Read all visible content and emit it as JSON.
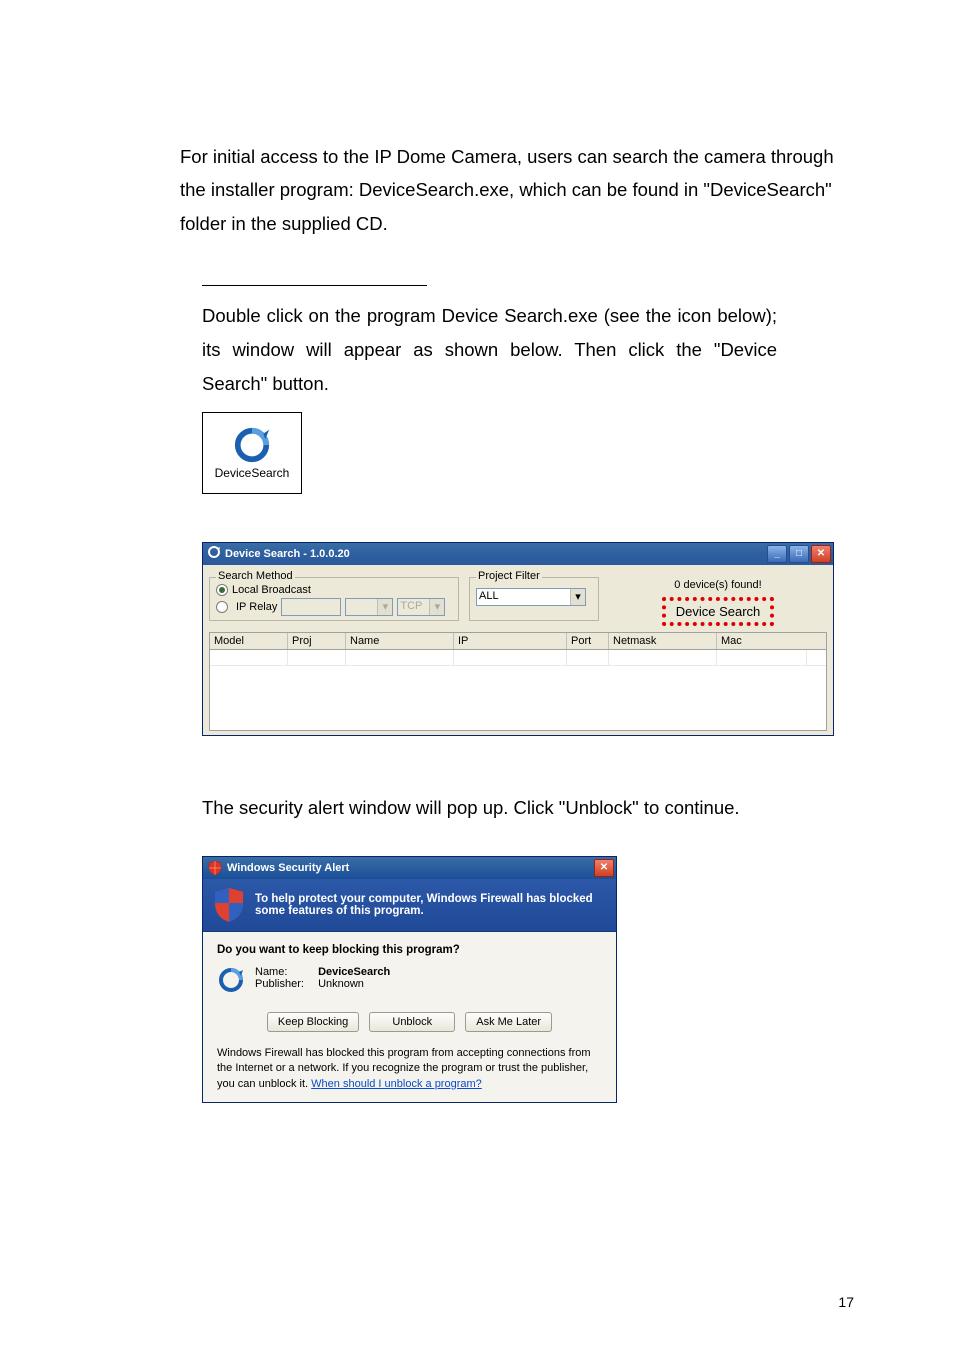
{
  "intro": "For initial access to the IP Dome Camera, users can search the camera through the installer program: DeviceSearch.exe, which can be found in \"DeviceSearch\" folder in the supplied CD.",
  "step": {
    "text": "Double click on the program Device Search.exe (see the icon below); its window will appear as shown below. Then click the \"Device Search\" button.",
    "icon_label": "DeviceSearch",
    "icon_name": "device-search-icon"
  },
  "ds_window": {
    "title": "Device Search - 1.0.0.20",
    "search_method": {
      "legend": "Search Method",
      "opt1": "Local Broadcast",
      "opt2": "IP Relay",
      "proto": "TCP"
    },
    "filter": {
      "legend": "Project Filter",
      "value": "ALL"
    },
    "found": "0 device(s) found!",
    "search_btn": "Device Search",
    "headers": [
      "Model",
      "Proj",
      "Name",
      "IP",
      "Port",
      "Netmask",
      "Mac"
    ]
  },
  "after_ds": "The security alert window will pop up. Click \"Unblock\" to continue.",
  "sa_window": {
    "title": "Windows Security Alert",
    "banner": "To help protect your computer,  Windows Firewall has blocked some features of this program.",
    "question": "Do you want to keep blocking this program?",
    "name_label": "Name:",
    "name_value": "DeviceSearch",
    "publisher_label": "Publisher:",
    "publisher_value": "Unknown",
    "btn_keep": "Keep Blocking",
    "btn_unblock": "Unblock",
    "btn_ask": "Ask Me Later",
    "foot_text": "Windows Firewall has blocked this program from accepting connections from the Internet or a network. If you recognize the program or trust the publisher, you can unblock it. ",
    "foot_link": "When should I unblock a program?"
  },
  "page_number": "17"
}
